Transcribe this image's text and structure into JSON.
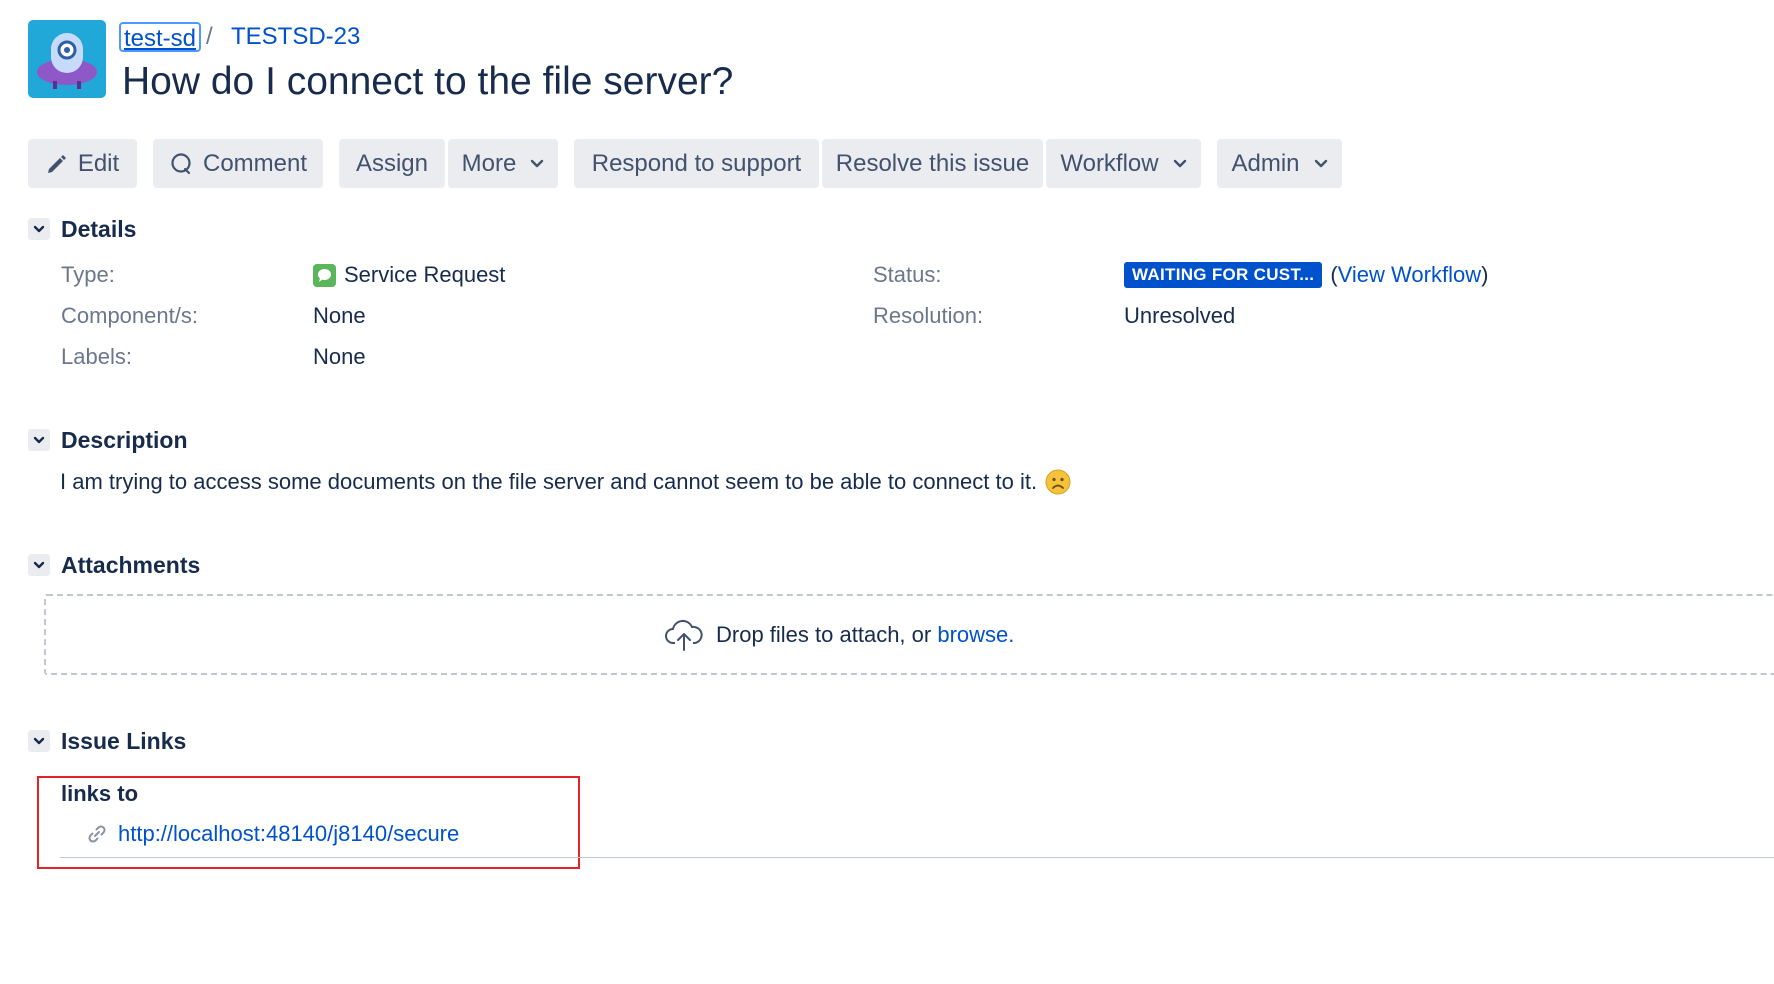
{
  "header": {
    "project_name": "test-sd",
    "separator": "/",
    "issue_key": "TESTSD-23",
    "title": "How do I connect to the file server?"
  },
  "toolbar": {
    "edit": "Edit",
    "comment": "Comment",
    "assign": "Assign",
    "more": "More",
    "respond": "Respond to support",
    "resolve": "Resolve this issue",
    "workflow": "Workflow",
    "admin": "Admin"
  },
  "details": {
    "heading": "Details",
    "type_label": "Type:",
    "type_value": "Service Request",
    "components_label": "Component/s:",
    "components_value": "None",
    "labels_label": "Labels:",
    "labels_value": "None",
    "status_label": "Status:",
    "status_value": "WAITING FOR CUST...",
    "view_workflow_open": "(",
    "view_workflow": "View Workflow",
    "view_workflow_close": ")",
    "resolution_label": "Resolution:",
    "resolution_value": "Unresolved"
  },
  "description": {
    "heading": "Description",
    "text": "I am trying to access some documents on the file server and cannot seem to be able to connect to it."
  },
  "attachments": {
    "heading": "Attachments",
    "drop_text": "Drop files to attach, or ",
    "browse": "browse",
    "period": "."
  },
  "issue_links": {
    "heading": "Issue Links",
    "relation": "links to",
    "url": "http://localhost:48140/j8140/secure"
  },
  "colors": {
    "link": "#0052cc",
    "status_badge": "#0052cc",
    "button_bg": "#ebecf0",
    "highlight_border": "#e5242a",
    "service_request_icon": "#5bb55b"
  }
}
